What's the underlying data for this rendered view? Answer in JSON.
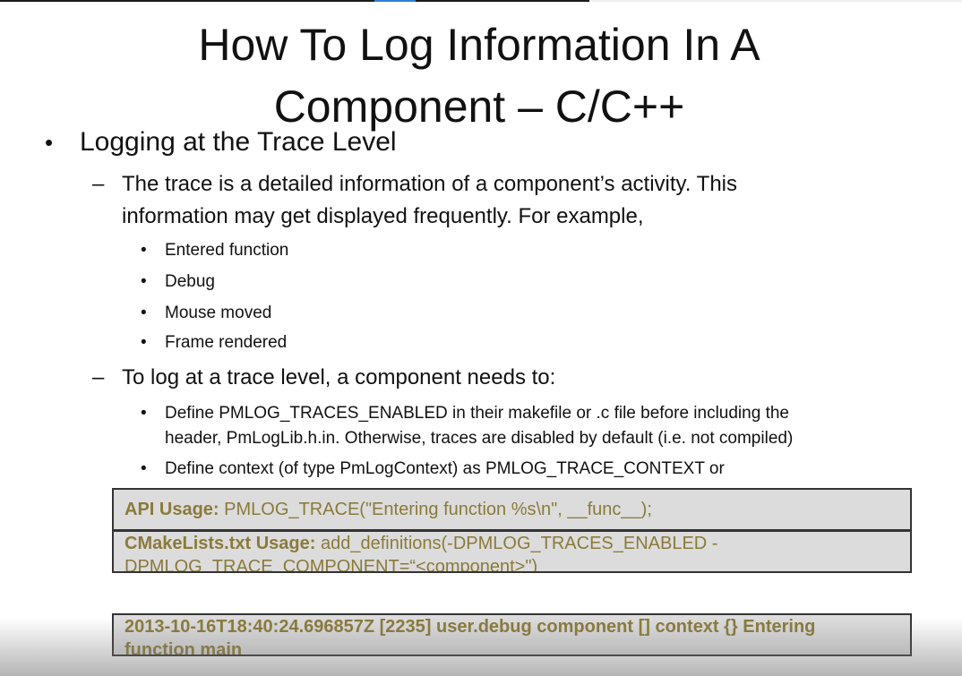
{
  "slide": {
    "title_line1": "How To Log Information In A",
    "title_line2": "Component – C/C++",
    "bullet_main": "Logging at the Trace Level",
    "sub1_line1": "The trace is a detailed information of a component’s activity. This",
    "sub1_line2": "information may get displayed frequently. For example,",
    "examples": [
      "Entered function",
      "Debug",
      "Mouse moved",
      "Frame rendered"
    ],
    "sub2": "To log at a trace level, a component needs to:",
    "req1_line1": "Define PMLOG_TRACES_ENABLED in their makefile or .c file before including the",
    "req1_line2": "header, PmLogLib.h.in. Otherwise, traces are disabled by default (i.e. not compiled)",
    "req2_line1": "Define context (of type PmLogContext) as PMLOG_TRACE_CONTEXT or",
    "bullet_glyph": "•",
    "dash_glyph": "–"
  },
  "boxes": {
    "api_label": "API Usage:",
    "api_code": " PMLOG_TRACE(\"Entering function %s\\n\", __func__);",
    "cmake_label": "CMakeLists.txt Usage:",
    "cmake_line1": " add_definitions(-DPMLOG_TRACES_ENABLED -",
    "cmake_line2": "DPMLOG_TRACE_COMPONENT=“<component>\")",
    "output_line1": "2013-10-16T18:40:24.696857Z [2235] user.debug component [] context {} Entering",
    "output_line2": "function main"
  },
  "colors": {
    "box_text": "#8a7a3a",
    "box_bg": "#dcdcdc"
  }
}
